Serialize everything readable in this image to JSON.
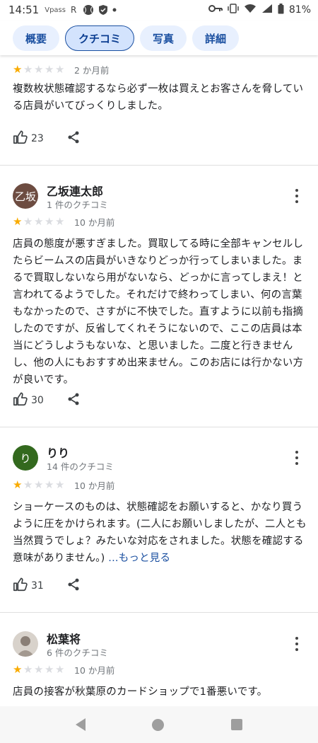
{
  "status_bar": {
    "time": "14:51",
    "icons": [
      "vpass-icon",
      "r-point-icon",
      "baseball-icon",
      "shield-icon",
      "dot-icon"
    ],
    "vpass_label": "Vpass",
    "battery_percent": "81%"
  },
  "tabs": [
    {
      "label": "概要",
      "active": false
    },
    {
      "label": "クチコミ",
      "active": true
    },
    {
      "label": "写真",
      "active": false
    },
    {
      "label": "詳細",
      "active": false
    }
  ],
  "reviews": [
    {
      "rating": 1,
      "max_rating": 5,
      "date": "2 か月前",
      "text": "複数枚状態確認するなら必ず一枚は買えとお客さんを脅している店員がいてびっくりしました。",
      "likes": "23"
    },
    {
      "author": "乙坂連太郎",
      "avatar_text": "乙坂",
      "avatar_color": "#6d4c41",
      "review_count": "1 件のクチコミ",
      "rating": 1,
      "max_rating": 5,
      "date": "10 か月前",
      "text": "店員の態度が悪すぎました。買取してる時に全部キャンセルしたらビームスの店員がいきなりどっか行ってしまいました。まるで買取しないなら用がないなら、どっかに言ってしまえ！と言われてるようでした。それだけで終わってしまい、何の言葉もなかったので、さすがに不快でした。直すように以前も指摘したのですが、反省してくれそうにないので、ここの店員は本当にどうしようもないな、と思いました。二度と行きませんし、他の人にもおすすめ出来ません。このお店には行かない方が良いです。",
      "likes": "30"
    },
    {
      "author": "りり",
      "avatar_text": "り",
      "avatar_color": "#33691e",
      "review_count": "14 件のクチコミ",
      "rating": 1,
      "max_rating": 5,
      "date": "10 か月前",
      "text": "ショーケースのものは、状態確認をお願いすると、かなり買うように圧をかけられます。(二人にお願いしましたが、二人とも当然買うでしょ？みたいな対応をされました。状態を確認する意味がありません。) ",
      "more_label": "...もっと見る",
      "likes": "31"
    },
    {
      "author": "松葉将",
      "avatar_color": "#b0a8a0",
      "review_count": "6 件のクチコミ",
      "rating": 1,
      "max_rating": 5,
      "date": "10 か月前",
      "text": "店員の接客が秋葉原のカードショップで1番悪いです。"
    }
  ]
}
